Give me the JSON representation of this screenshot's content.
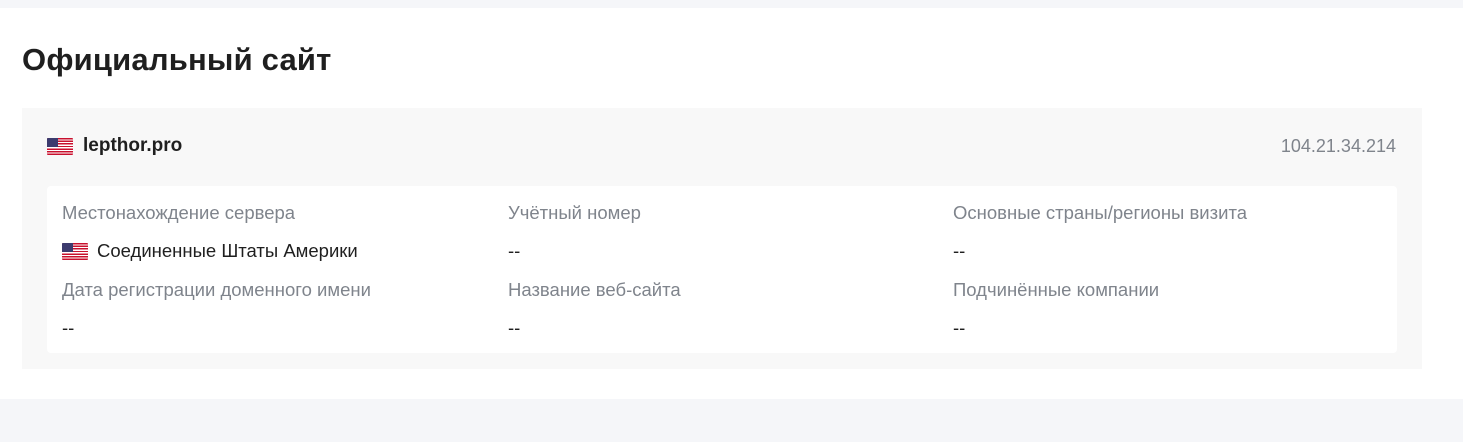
{
  "section": {
    "title": "Официальный сайт"
  },
  "site": {
    "domain": "lepthor.pro",
    "ip": "104.21.34.214",
    "flag_icon": "us-flag-icon"
  },
  "fields": {
    "server_location": {
      "label": "Местонахождение сервера",
      "value": "Соединенные Штаты Америки"
    },
    "account_number": {
      "label": "Учётный номер",
      "value": "--"
    },
    "main_countries": {
      "label": "Основные страны/регионы визита",
      "value": "--"
    },
    "domain_registration_date": {
      "label": "Дата регистрации доменного имени",
      "value": "--"
    },
    "website_name": {
      "label": "Название веб-сайта",
      "value": "--"
    },
    "subsidiaries": {
      "label": "Подчинённые компании",
      "value": "--"
    }
  },
  "colors": {
    "background": "#f5f6f9",
    "panel": "#ffffff",
    "card": "#f8f8f8",
    "label": "#7f848c",
    "text": "#1f1f1f"
  }
}
